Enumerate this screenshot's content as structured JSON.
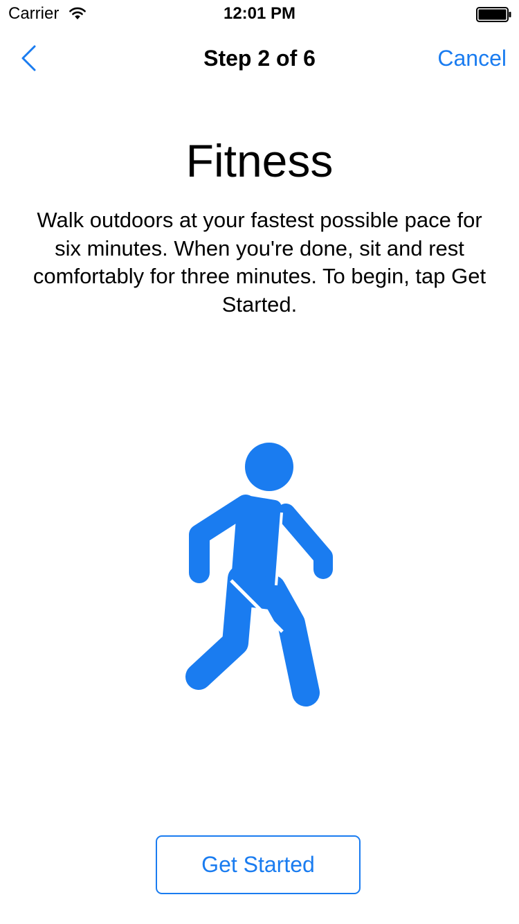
{
  "colors": {
    "accent": "#1a7cf0",
    "text": "#000000",
    "background": "#ffffff"
  },
  "status_bar": {
    "carrier": "Carrier",
    "time": "12:01 PM",
    "wifi_icon": "wifi-icon",
    "battery_icon": "battery-icon",
    "battery_level": 1.0
  },
  "nav_bar": {
    "back_icon": "chevron-left-icon",
    "title": "Step 2 of 6",
    "cancel_label": "Cancel"
  },
  "content": {
    "title": "Fitness",
    "description": "Walk outdoors at your fastest possible pace for six minutes. When you're done, sit and rest comfortably for three minutes. To begin, tap Get Started.",
    "illustration_icon": "walking-person-icon"
  },
  "footer": {
    "get_started_label": "Get Started"
  }
}
